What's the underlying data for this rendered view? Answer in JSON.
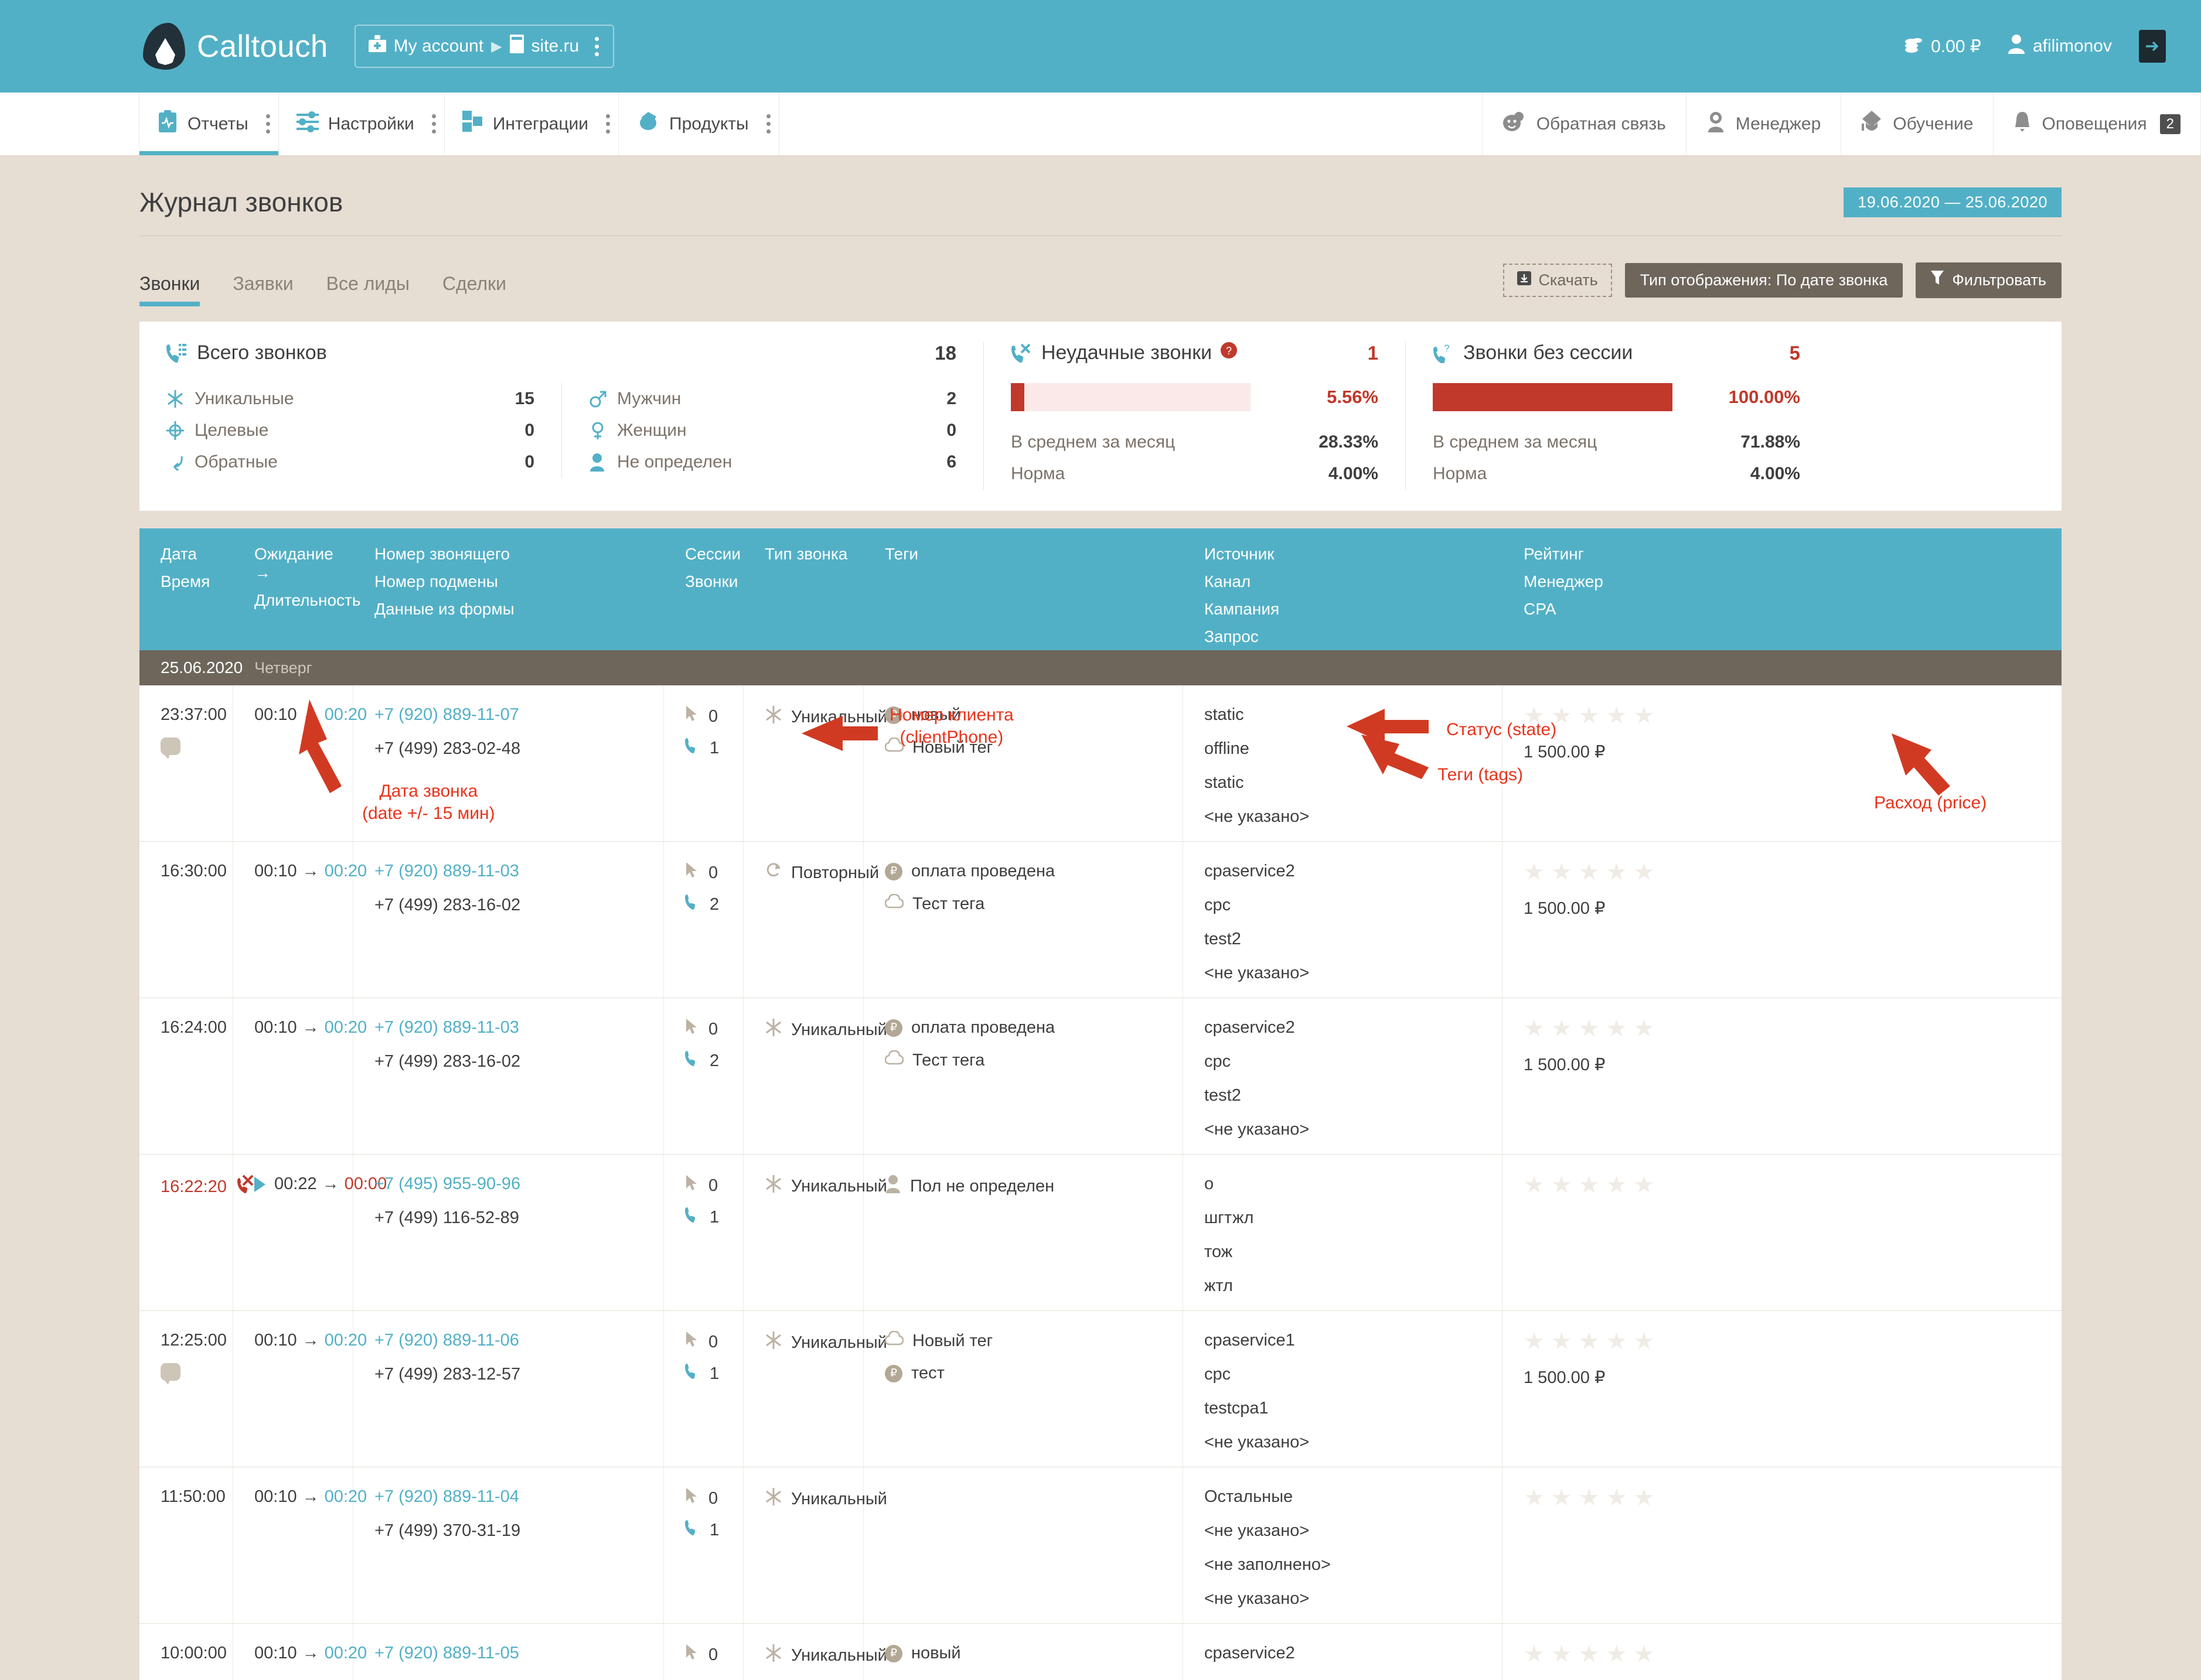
{
  "topbar": {
    "brand": "Calltouch",
    "account": "My account",
    "site": "site.ru",
    "balance": "0.00 ₽",
    "user": "afilimonov"
  },
  "nav": {
    "left": [
      {
        "label": "Отчеты",
        "icon": "report-icon",
        "active": true
      },
      {
        "label": "Настройки",
        "icon": "settings-icon",
        "active": false
      },
      {
        "label": "Интеграции",
        "icon": "integrations-icon",
        "active": false
      },
      {
        "label": "Продукты",
        "icon": "products-icon",
        "active": false
      }
    ],
    "right": [
      {
        "label": "Обратная связь",
        "icon": "feedback-icon"
      },
      {
        "label": "Менеджер",
        "icon": "manager-icon"
      },
      {
        "label": "Обучение",
        "icon": "education-icon"
      },
      {
        "label": "Оповещения",
        "icon": "bell-icon",
        "badge": "2"
      }
    ]
  },
  "page": {
    "title": "Журнал звонков",
    "date_range": "19.06.2020  —  25.06.2020",
    "tabs": [
      {
        "label": "Звонки",
        "active": true
      },
      {
        "label": "Заявки",
        "active": false
      },
      {
        "label": "Все лиды",
        "active": false
      },
      {
        "label": "Сделки",
        "active": false
      }
    ],
    "toolbar": {
      "download": "Скачать",
      "display_type": "Тип отображения: По дате звонка",
      "filter": "Фильтровать"
    }
  },
  "stats": {
    "total": {
      "title": "Всего звонков",
      "value": "18",
      "left": [
        {
          "label": "Уникальные",
          "value": "15",
          "icon": "unique-icon"
        },
        {
          "label": "Целевые",
          "value": "0",
          "icon": "target-icon"
        },
        {
          "label": "Обратные",
          "value": "0",
          "icon": "callback-icon"
        }
      ],
      "right": [
        {
          "label": "Мужчин",
          "value": "2",
          "icon": "male-icon"
        },
        {
          "label": "Женщин",
          "value": "0",
          "icon": "female-icon"
        },
        {
          "label": "Не определен",
          "value": "6",
          "icon": "person-icon"
        }
      ]
    },
    "failed": {
      "title": "Неудачные звонки",
      "value": "1",
      "percent": "5.56%",
      "bar_fill": 5.56,
      "avg_label": "В среднем за месяц",
      "avg_value": "28.33%",
      "norm_label": "Норма",
      "norm_value": "4.00%"
    },
    "nosession": {
      "title": "Звонки без сессии",
      "value": "5",
      "percent": "100.00%",
      "bar_fill": 100,
      "avg_label": "В среднем за месяц",
      "avg_value": "71.88%",
      "norm_label": "Норма",
      "norm_value": "4.00%"
    }
  },
  "table": {
    "headers": {
      "date": [
        "Дата",
        "Время"
      ],
      "wait": [
        "Ожидание →",
        "Длительность"
      ],
      "number": [
        "Номер звонящего",
        "Номер подмены",
        "Данные из формы"
      ],
      "sessions": [
        "Сессии",
        "Звонки"
      ],
      "calltype": [
        "Тип звонка"
      ],
      "tags": [
        "Теги"
      ],
      "source": [
        "Источник",
        "Канал",
        "Кампания",
        "Запрос"
      ],
      "rating": [
        "Рейтинг",
        "Менеджер",
        "CPA"
      ]
    },
    "daygroup": {
      "date": "25.06.2020",
      "dow": "Четверг"
    },
    "rows": [
      {
        "time": "23:37:00",
        "time_red": false,
        "has_bubble": true,
        "missed": false,
        "has_play": false,
        "wait": "00:10",
        "duration": "00:20",
        "duration_red": false,
        "client_phone": "+7 (920) 889-11-07",
        "redirect_phone": "+7 (499) 283-02-48",
        "sessions": "0",
        "calls": "1",
        "call_type": "Уникальный",
        "call_type_icon": "unique-icon",
        "tags": [
          {
            "label": "новый",
            "icon": "ruble-badge"
          },
          {
            "label": "Новый тег",
            "icon": "cloud-icon"
          }
        ],
        "source": [
          "static",
          "offline",
          "static",
          "<не указано>"
        ],
        "stars": 5,
        "price": "1 500.00 ₽"
      },
      {
        "time": "16:30:00",
        "time_red": false,
        "has_bubble": false,
        "missed": false,
        "has_play": false,
        "wait": "00:10",
        "duration": "00:20",
        "duration_red": false,
        "client_phone": "+7 (920) 889-11-03",
        "redirect_phone": "+7 (499) 283-16-02",
        "sessions": "0",
        "calls": "2",
        "call_type": "Повторный",
        "call_type_icon": "repeat-icon",
        "tags": [
          {
            "label": "оплата проведена",
            "icon": "ruble-badge"
          },
          {
            "label": "Тест тега",
            "icon": "cloud-icon"
          }
        ],
        "source": [
          "cpaservice2",
          "cpc",
          "test2",
          "<не указано>"
        ],
        "stars": 5,
        "price": "1 500.00 ₽"
      },
      {
        "time": "16:24:00",
        "time_red": false,
        "has_bubble": false,
        "missed": false,
        "has_play": false,
        "wait": "00:10",
        "duration": "00:20",
        "duration_red": false,
        "client_phone": "+7 (920) 889-11-03",
        "redirect_phone": "+7 (499) 283-16-02",
        "sessions": "0",
        "calls": "2",
        "call_type": "Уникальный",
        "call_type_icon": "unique-icon",
        "tags": [
          {
            "label": "оплата проведена",
            "icon": "ruble-badge"
          },
          {
            "label": "Тест тега",
            "icon": "cloud-icon"
          }
        ],
        "source": [
          "cpaservice2",
          "cpc",
          "test2",
          "<не указано>"
        ],
        "stars": 5,
        "price": "1 500.00 ₽"
      },
      {
        "time": "16:22:20",
        "time_red": true,
        "has_bubble": false,
        "missed": true,
        "has_play": true,
        "wait": "00:22",
        "duration": "00:00",
        "duration_red": true,
        "client_phone": "+7 (495) 955-90-96",
        "redirect_phone": "+7 (499) 116-52-89",
        "sessions": "0",
        "calls": "1",
        "call_type": "Уникальный",
        "call_type_icon": "unique-icon",
        "tags": [
          {
            "label": "Пол не определен",
            "icon": "person-icon"
          }
        ],
        "source": [
          "о",
          "шгтжл",
          "тож",
          "жтл"
        ],
        "stars": 5,
        "price": ""
      },
      {
        "time": "12:25:00",
        "time_red": false,
        "has_bubble": true,
        "missed": false,
        "has_play": false,
        "wait": "00:10",
        "duration": "00:20",
        "duration_red": false,
        "client_phone": "+7 (920) 889-11-06",
        "redirect_phone": "+7 (499) 283-12-57",
        "sessions": "0",
        "calls": "1",
        "call_type": "Уникальный",
        "call_type_icon": "unique-icon",
        "tags": [
          {
            "label": "Новый тег",
            "icon": "cloud-icon"
          },
          {
            "label": "тест",
            "icon": "ruble-badge"
          }
        ],
        "source": [
          "cpaservice1",
          "cpc",
          "testcpa1",
          "<не указано>"
        ],
        "stars": 5,
        "price": "1 500.00 ₽"
      },
      {
        "time": "11:50:00",
        "time_red": false,
        "has_bubble": false,
        "missed": false,
        "has_play": false,
        "wait": "00:10",
        "duration": "00:20",
        "duration_red": false,
        "client_phone": "+7 (920) 889-11-04",
        "redirect_phone": "+7 (499) 370-31-19",
        "sessions": "0",
        "calls": "1",
        "call_type": "Уникальный",
        "call_type_icon": "unique-icon",
        "tags": [],
        "source": [
          "Остальные",
          "<не указано>",
          "<не заполнено>",
          "<не указано>"
        ],
        "stars": 5,
        "price": ""
      },
      {
        "time": "10:00:00",
        "time_red": false,
        "has_bubble": false,
        "missed": false,
        "has_play": false,
        "wait": "00:10",
        "duration": "00:20",
        "duration_red": false,
        "client_phone": "+7 (920) 889-11-05",
        "redirect_phone": "",
        "sessions": "0",
        "calls": "",
        "call_type": "Уникальный",
        "call_type_icon": "unique-icon",
        "tags": [
          {
            "label": "новый",
            "icon": "ruble-badge"
          }
        ],
        "source": [
          "cpaservice2"
        ],
        "stars": 5,
        "price": ""
      }
    ]
  },
  "annotations": [
    {
      "id": "a1",
      "text": "Номер клиента\n(clientPhone)"
    },
    {
      "id": "a2",
      "text": "Дата звонка\n(date +/- 15 мин)"
    },
    {
      "id": "a3",
      "text": "Статус (state)"
    },
    {
      "id": "a4",
      "text": "Теги (tags)"
    },
    {
      "id": "a5",
      "text": "Расход (price)"
    }
  ],
  "colors": {
    "accent": "#52b0c6",
    "page_bg": "#e6ddd3",
    "dark_button": "#6e665b",
    "danger": "#c0392b",
    "annotation": "#e8341c"
  }
}
